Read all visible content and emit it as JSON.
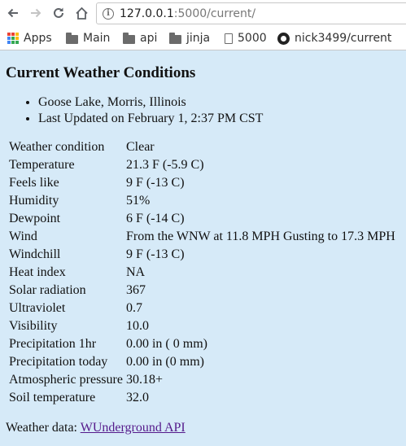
{
  "browser": {
    "url_host": "127.0.0.1",
    "url_path": ":5000/current/",
    "bookmarks": [
      {
        "label": "Apps",
        "icon": "apps-grid-icon"
      },
      {
        "label": "Main",
        "icon": "folder-icon"
      },
      {
        "label": "api",
        "icon": "folder-icon"
      },
      {
        "label": "jinja",
        "icon": "folder-icon"
      },
      {
        "label": "5000",
        "icon": "page-icon"
      },
      {
        "label": "nick3499/current",
        "icon": "github-icon"
      }
    ]
  },
  "page": {
    "title": "Current Weather Conditions",
    "location": "Goose Lake, Morris, Illinois",
    "updated": "Last Updated on February 1, 2:37 PM CST",
    "rows": [
      {
        "label": "Weather condition",
        "value": "Clear"
      },
      {
        "label": "Temperature",
        "value": "21.3 F (-5.9 C)"
      },
      {
        "label": "Feels like",
        "value": "9 F (-13 C)"
      },
      {
        "label": "Humidity",
        "value": "51%"
      },
      {
        "label": "Dewpoint",
        "value": "6 F (-14 C)"
      },
      {
        "label": "Wind",
        "value": "From the WNW at 11.8 MPH Gusting to 17.3 MPH"
      },
      {
        "label": "Windchill",
        "value": "9 F (-13 C)"
      },
      {
        "label": "Heat index",
        "value": "NA"
      },
      {
        "label": "Solar radiation",
        "value": "367"
      },
      {
        "label": "Ultraviolet",
        "value": "0.7"
      },
      {
        "label": "Visibility",
        "value": "10.0"
      },
      {
        "label": "Precipitation 1hr",
        "value": "0.00 in ( 0 mm)"
      },
      {
        "label": "Precipitation today",
        "value": "0.00 in (0 mm)"
      },
      {
        "label": "Atmospheric pressure",
        "value": "30.18+"
      },
      {
        "label": "Soil temperature",
        "value": "32.0"
      }
    ],
    "footer_prefix": "Weather data:",
    "footer_link": "WUnderground API"
  },
  "colors": {
    "page_background": "#d6eaf8",
    "link": "#551a8b"
  }
}
